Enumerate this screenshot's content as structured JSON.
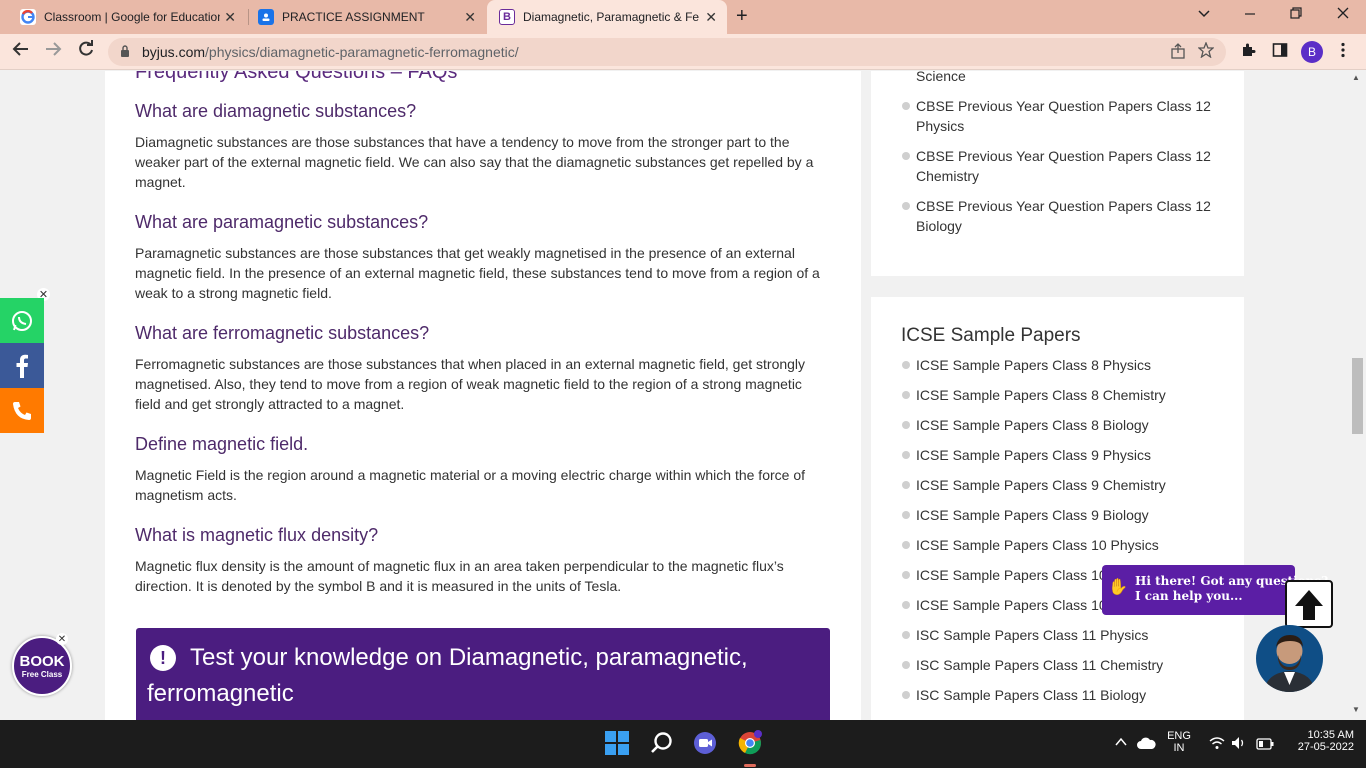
{
  "browser": {
    "tabs": [
      {
        "title": "Classroom | Google for Education",
        "favicon": "google-icon",
        "close": "✕"
      },
      {
        "title": "PRACTICE ASSIGNMENT",
        "favicon": "classroom-icon",
        "close": "✕"
      },
      {
        "title": "Diamagnetic, Paramagnetic & Fe",
        "favicon": "byjus-icon",
        "close": "✕",
        "active": true
      }
    ],
    "new_tab": "+",
    "url_domain": "byjus.com",
    "url_path": "/physics/diamagnetic-paramagnetic-ferromagnetic/",
    "profile_initial": "B"
  },
  "main": {
    "faq_heading": "Frequently Asked Questions – FAQs",
    "faqs": [
      {
        "q": "What are diamagnetic substances?",
        "a": "Diamagnetic substances are those substances that have a tendency to move from the stronger part to the weaker part of the external magnetic field. We can also say that the diamagnetic substances get repelled by a magnet."
      },
      {
        "q": "What are paramagnetic substances?",
        "a": "Paramagnetic substances are those substances that get weakly magnetised in the presence of an external magnetic field. In the presence of an external magnetic field, these substances tend to move from a region of a weak to a strong magnetic field."
      },
      {
        "q": "What are ferromagnetic substances?",
        "a": "Ferromagnetic substances are those substances that when placed in an external magnetic field, get strongly magnetised. Also, they tend to move from a region of weak magnetic field to the region of a strong magnetic field and get strongly attracted to a magnet."
      },
      {
        "q": "Define magnetic field.",
        "a": "Magnetic Field is the region around a magnetic material or a moving electric charge within which the force of magnetism acts."
      },
      {
        "q": "What is magnetic flux density?",
        "a": "Magnetic flux density is the amount of magnetic flux in an area taken perpendicular to the magnetic flux’s direction. It is denoted by the symbol B and it is measured in the units of Tesla."
      }
    ],
    "test_box_title": "Test your knowledge on Diamagnetic, paramagnetic, ferromagnetic",
    "test_box_icon": "!"
  },
  "sidebar": {
    "cbse_items": [
      "Science",
      "CBSE Previous Year Question Papers Class 12 Physics",
      "CBSE Previous Year Question Papers Class 12 Chemistry",
      "CBSE Previous Year Question Papers Class 12 Biology"
    ],
    "icse_title": "ICSE Sample Papers",
    "icse_items": [
      "ICSE Sample Papers Class 8 Physics",
      "ICSE Sample Papers Class 8 Chemistry",
      "ICSE Sample Papers Class 8 Biology",
      "ICSE Sample Papers Class 9 Physics",
      "ICSE Sample Papers Class 9 Chemistry",
      "ICSE Sample Papers Class 9 Biology",
      "ICSE Sample Papers Class 10 Physics",
      "ICSE Sample Papers Class 10",
      "ICSE Sample Papers Class 10",
      "ISC Sample Papers Class 11 Physics",
      "ISC Sample Papers Class 11 Chemistry",
      "ISC Sample Papers Class 11 Biology"
    ]
  },
  "widgets": {
    "book_line1": "BOOK",
    "book_line2": "Free Class",
    "chat_line1": "Hi there! Got any questions?",
    "chat_line2": "I can help you...",
    "close_glyph": "✕"
  },
  "taskbar": {
    "lang": "ENG",
    "region": "IN",
    "time": "10:35 AM",
    "date": "27-05-2022"
  },
  "colors": {
    "whatsapp": "#25d366",
    "facebook": "#3b5998",
    "phone": "#ff7a00",
    "brand": "#4b1d80"
  }
}
